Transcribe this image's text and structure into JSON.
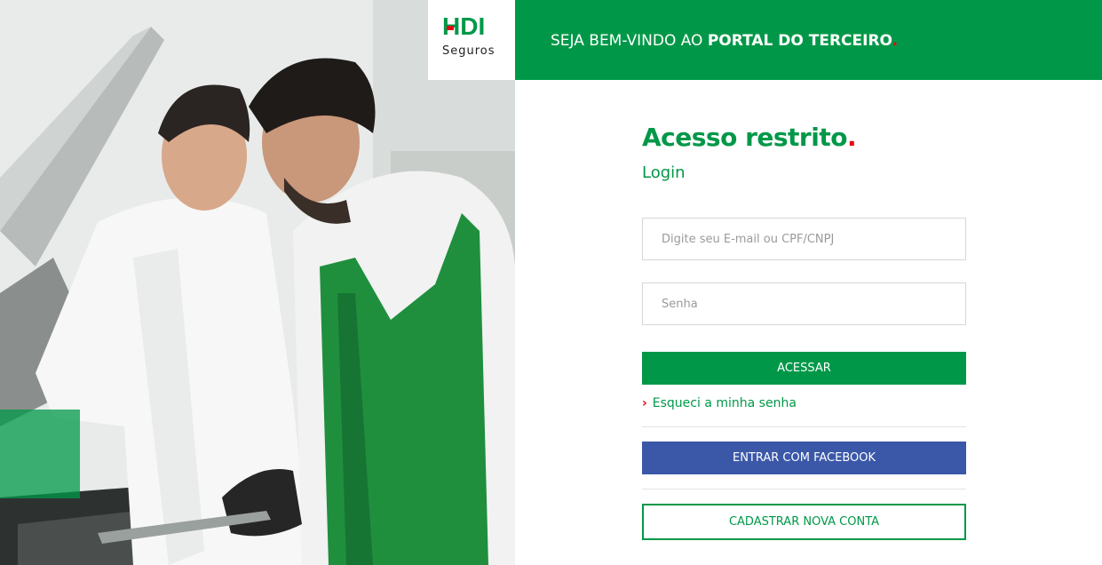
{
  "brand": {
    "logo_text": "HDI",
    "logo_sub": "Seguros",
    "green": "#009848",
    "red": "#e30613",
    "facebook_blue": "#3b58a8"
  },
  "header": {
    "welcome_light": "SEJA BEM-VINDO AO ",
    "welcome_bold": "PORTAL DO TERCEIRO",
    "dot": "."
  },
  "form": {
    "title": "Acesso restrito",
    "title_dot": ".",
    "subtitle": "Login",
    "email_placeholder": "Digite seu E-mail ou CPF/CNPJ",
    "email_value": "",
    "password_placeholder": "Senha",
    "password_value": "",
    "login_label": "ACESSAR",
    "forgot_label": "Esqueci a minha senha",
    "facebook_label": "ENTRAR COM FACEBOOK",
    "register_label": "CADASTRAR NOVA CONTA"
  },
  "icons": {
    "forgot_arrow": "chevron-right-icon"
  }
}
